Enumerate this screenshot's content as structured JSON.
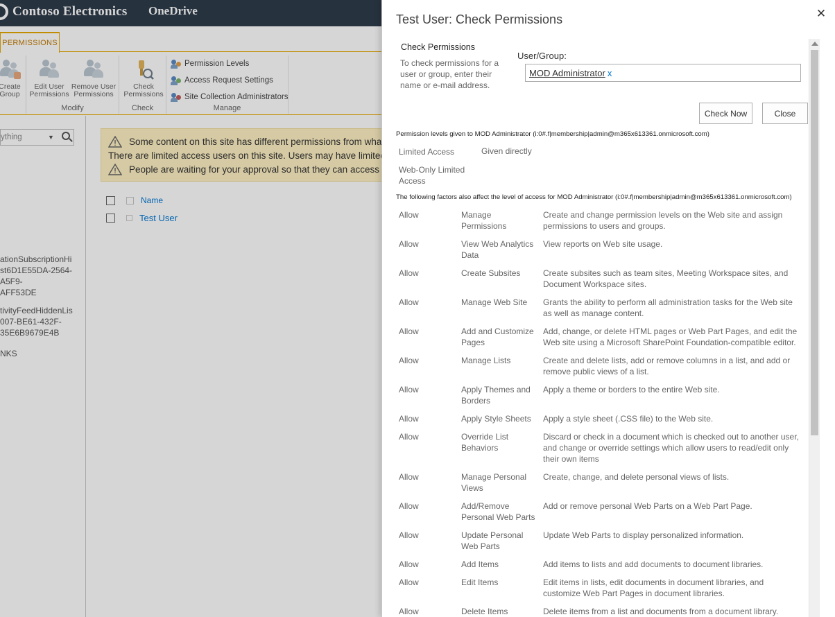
{
  "header": {
    "brand": "Contoso Electronics",
    "app": "OneDrive"
  },
  "ribbon": {
    "tab": "PERMISSIONS",
    "buttons": {
      "create_group": "Create\nGroup",
      "edit_user_permissions": "Edit User\nPermissions",
      "remove_user_permissions": "Remove User\nPermissions",
      "check_permissions": "Check\nPermissions"
    },
    "small": {
      "permission_levels": "Permission Levels",
      "access_request_settings": "Access Request Settings",
      "site_collection_administrators": "Site Collection Administrators"
    },
    "groups": {
      "modify": "Modify",
      "check": "Check",
      "manage": "Manage"
    }
  },
  "leftnav": {
    "search_placeholder": "ything",
    "links": [
      "ationSubscriptionHi\nst6D1E55DA-2564-\nA5F9-\nAFF53DE",
      "tivityFeedHiddenLis\n007-BE61-432F-\n35E6B9679E4B",
      "NKS"
    ]
  },
  "banner": {
    "line1": "Some content on this site has different permissions from what you see here.",
    "line2": "There are limited access users on this site. Users may have limited access if an item or document under the site has been shared with them.",
    "line3": "People are waiting for your approval so that they can access this site."
  },
  "list": {
    "name_header": "Name",
    "row_name": "Test User"
  },
  "dialog": {
    "title": "Test User: Check Permissions",
    "close": "✕",
    "check_heading": "Check Permissions",
    "check_description": "To check permissions for a user or group, enter their name or e-mail address.",
    "user_group_label": "User/Group:",
    "user_name": "MOD Administrator",
    "user_remove": "x",
    "check_now": "Check Now",
    "close_button": "Close",
    "levels_title": "Permission levels given to MOD Administrator (i:0#.f|membership|admin@m365x613361.onmicrosoft.com)",
    "levels": [
      {
        "name": "Limited Access",
        "how": "Given directly"
      },
      {
        "name": "Web-Only Limited Access",
        "how": ""
      }
    ],
    "factors_title": "The following factors also affect the level of access for MOD Administrator (i:0#.f|membership|admin@m365x613361.onmicrosoft.com)",
    "permissions": [
      {
        "allow": "Allow",
        "name": "Manage Permissions",
        "desc": "Create and change permission levels on the Web site and assign permissions to users and groups."
      },
      {
        "allow": "Allow",
        "name": "View Web Analytics Data",
        "desc": "View reports on Web site usage."
      },
      {
        "allow": "Allow",
        "name": "Create Subsites",
        "desc": "Create subsites such as team sites, Meeting Workspace sites, and Document Workspace sites."
      },
      {
        "allow": "Allow",
        "name": "Manage Web Site",
        "desc": "Grants the ability to perform all administration tasks for the Web site as well as manage content."
      },
      {
        "allow": "Allow",
        "name": "Add and Customize Pages",
        "desc": "Add, change, or delete HTML pages or Web Part Pages, and edit the Web site using a Microsoft SharePoint Foundation-compatible editor."
      },
      {
        "allow": "Allow",
        "name": "Manage Lists",
        "desc": "Create and delete lists, add or remove columns in a list, and add or remove public views of a list."
      },
      {
        "allow": "Allow",
        "name": "Apply Themes and Borders",
        "desc": "Apply a theme or borders to the entire Web site."
      },
      {
        "allow": "Allow",
        "name": "Apply Style Sheets",
        "desc": "Apply a style sheet (.CSS file) to the Web site."
      },
      {
        "allow": "Allow",
        "name": "Override List Behaviors",
        "desc": "Discard or check in a document which is checked out to another user, and change or override settings which allow users to read/edit only their own items"
      },
      {
        "allow": "Allow",
        "name": "Manage Personal Views",
        "desc": "Create, change, and delete personal views of lists."
      },
      {
        "allow": "Allow",
        "name": "Add/Remove Personal Web Parts",
        "desc": "Add or remove personal Web Parts on a Web Part Page."
      },
      {
        "allow": "Allow",
        "name": "Update Personal Web Parts",
        "desc": "Update Web Parts to display personalized information."
      },
      {
        "allow": "Allow",
        "name": "Add Items",
        "desc": "Add items to lists and add documents to document libraries."
      },
      {
        "allow": "Allow",
        "name": "Edit Items",
        "desc": "Edit items in lists, edit documents in document libraries, and customize Web Part Pages in document libraries."
      },
      {
        "allow": "Allow",
        "name": "Delete Items",
        "desc": "Delete items from a list and documents from a document library."
      }
    ]
  }
}
